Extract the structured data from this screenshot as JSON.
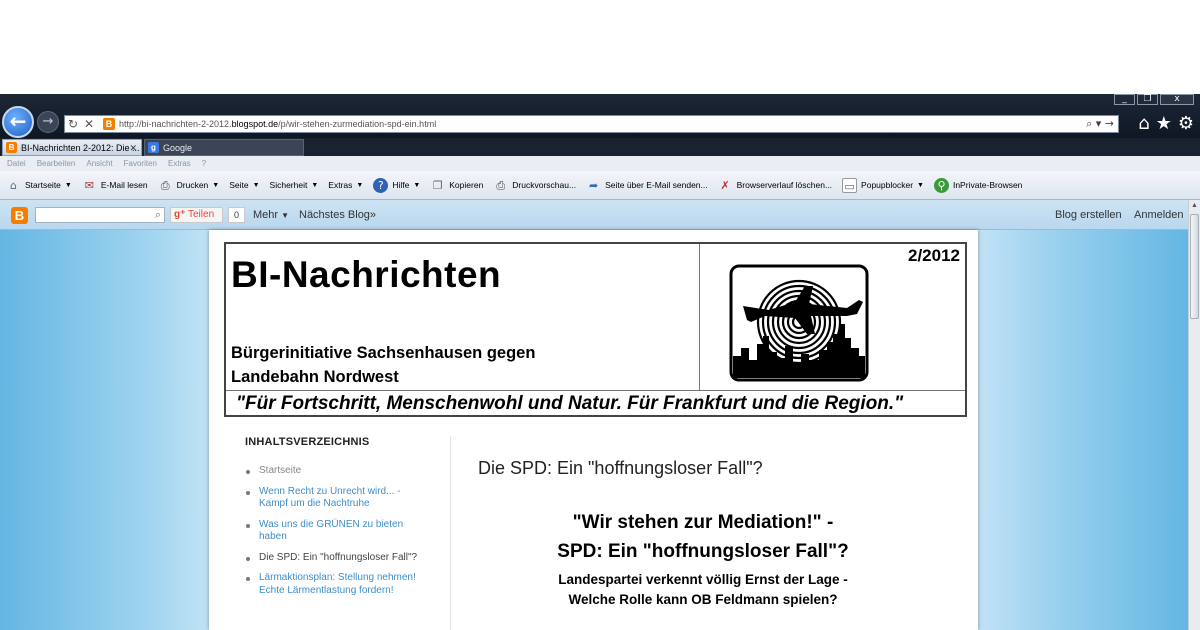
{
  "browser": {
    "window_controls": [
      "_",
      "❐",
      "x"
    ],
    "url_prefix": "http://bi-nachrichten-2-2012.",
    "url_domain": "blogspot.de",
    "url_path": "/p/wir-stehen-zurmediation-spd-ein.html",
    "tabs": [
      {
        "label": "BI-Nachrichten 2-2012: Die ...",
        "favicon": "B",
        "active": true
      },
      {
        "label": "Google",
        "favicon": "g",
        "active": false
      }
    ],
    "menu": [
      "Datei",
      "Bearbeiten",
      "Ansicht",
      "Favoriten",
      "Extras",
      "?"
    ],
    "commands": [
      {
        "label": "Startseite",
        "icon": "home-icon"
      },
      {
        "label": "E-Mail lesen",
        "icon": "mail-icon"
      },
      {
        "label": "Drucken",
        "icon": "print-icon"
      },
      {
        "label": "Seite",
        "icon": ""
      },
      {
        "label": "Sicherheit",
        "icon": ""
      },
      {
        "label": "Extras",
        "icon": ""
      },
      {
        "label": "Hilfe",
        "icon": "help-icon"
      },
      {
        "label": "Kopieren",
        "icon": "copy-icon"
      },
      {
        "label": "Druckvorschau...",
        "icon": "print-preview-icon"
      },
      {
        "label": "Seite über E-Mail senden...",
        "icon": "send-page-icon"
      },
      {
        "label": "Browserverlauf löschen...",
        "icon": "delete-history-icon"
      },
      {
        "label": "Popupblocker",
        "icon": "popup-blocker-icon"
      },
      {
        "label": "InPrivate-Browsen",
        "icon": "inprivate-icon"
      }
    ]
  },
  "navbar": {
    "search_placeholder": "",
    "gplus_label": "Teilen",
    "gplus_count": "0",
    "more": "Mehr",
    "next_blog": "Nächstes Blog»",
    "create_blog": "Blog erstellen",
    "sign_in": "Anmelden"
  },
  "header": {
    "title": "BI-Nachrichten",
    "issue": "2/2012",
    "subtitle_line1": "Bürgerinitiative Sachsenhausen gegen",
    "subtitle_line2": "Landebahn Nordwest",
    "slogan": "\"Für Fortschritt, Menschenwohl und Natur. Für Frankfurt und die Region.\""
  },
  "sidebar": {
    "heading": "INHALTSVERZEICHNIS",
    "items": [
      {
        "label": "Startseite",
        "state": "muted"
      },
      {
        "label": "Wenn Recht zu Unrecht wird... - Kampf um die Nachtruhe",
        "state": "link"
      },
      {
        "label": "Was uns die GRÜNEN zu bieten haben",
        "state": "link"
      },
      {
        "label": "Die SPD: Ein \"hoffnungsloser Fall\"?",
        "state": "current"
      },
      {
        "label": "Lärmaktionsplan: Stellung nehmen! Echte Lärmentlastung fordern!",
        "state": "link"
      }
    ]
  },
  "post": {
    "title": "Die SPD: Ein \"hoffnungsloser Fall\"?",
    "headline1": "\"Wir stehen zur Mediation!\" -",
    "headline2": "SPD: Ein \"hoffnungsloser Fall\"?",
    "subhead1": "Landespartei verkennt völlig Ernst der Lage -",
    "subhead2": "Welche Rolle kann OB Feldmann spielen?"
  }
}
